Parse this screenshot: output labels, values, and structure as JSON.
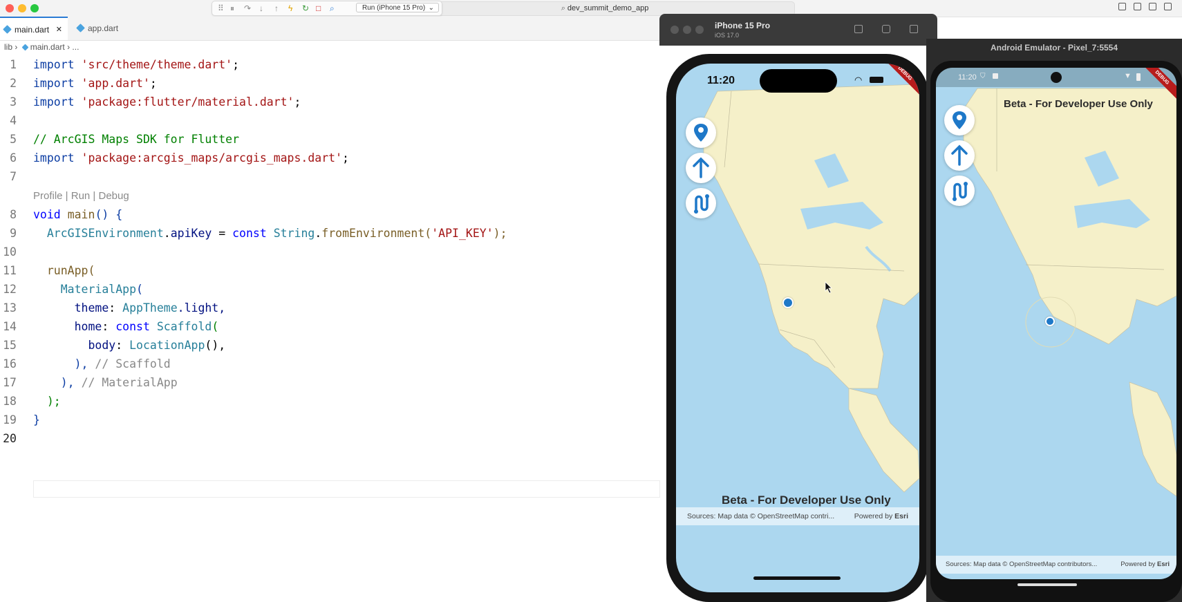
{
  "window": {
    "project_title": "dev_summit_demo_app"
  },
  "debug_toolbar": {
    "run_config": "Run (iPhone 15 Pro)"
  },
  "tabs": [
    {
      "label": "main.dart"
    },
    {
      "label": "app.dart"
    }
  ],
  "tab_close_glyph": "✕",
  "breadcrumb": {
    "folder": "lib",
    "file": "main.dart",
    "more": "..."
  },
  "code_lens": "Profile | Run | Debug",
  "code": {
    "line_numbers": [
      "1",
      "2",
      "3",
      "4",
      "5",
      "6",
      "7",
      "8",
      "9",
      "10",
      "11",
      "12",
      "13",
      "14",
      "15",
      "16",
      "17",
      "18",
      "19",
      "20"
    ],
    "l1": {
      "kw": "import",
      "str": "'src/theme/theme.dart'",
      "end": ";"
    },
    "l2": {
      "kw": "import",
      "str": "'app.dart'",
      "end": ";"
    },
    "l3": {
      "kw": "import",
      "str": "'package:flutter/material.dart'",
      "end": ";"
    },
    "l5": {
      "comment": "// ArcGIS Maps SDK for Flutter"
    },
    "l6": {
      "kw": "import",
      "str": "'package:arcgis_maps/arcgis_maps.dart'",
      "end": ";"
    },
    "l8": {
      "kw": "void",
      "fn": "main",
      "rest": "() {"
    },
    "l9": {
      "class": "ArcGISEnvironment",
      "dot": ".",
      "prop": "apiKey",
      "eq": " = ",
      "kw": "const",
      "type": "String",
      "dot2": ".",
      "fn": "fromEnvironment",
      "open": "(",
      "str": "'API_KEY'",
      "close": ");"
    },
    "l11": {
      "fn": "runApp",
      "open": "("
    },
    "l12": {
      "class": "MaterialApp",
      "open": "("
    },
    "l13": {
      "prop": "theme",
      "colon": ": ",
      "class": "AppTheme",
      "rest": ".light,"
    },
    "l14": {
      "prop": "home",
      "colon": ": ",
      "kw": "const",
      "class": "Scaffold",
      "open": "("
    },
    "l15": {
      "prop": "body",
      "colon": ": ",
      "class": "LocationApp",
      "rest": "(),"
    },
    "l16": {
      "rest": "), ",
      "comment": "// Scaffold"
    },
    "l17": {
      "rest": "), ",
      "comment": "// MaterialApp"
    },
    "l18": {
      "rest": ");"
    },
    "l19": {
      "rest": "}"
    }
  },
  "ios_sim": {
    "title": "iPhone 15 Pro",
    "subtitle": "iOS 17.0",
    "time": "11:20",
    "beta": "Beta - For Developer Use Only",
    "attribution": "Sources: Map data © OpenStreetMap contri...",
    "powered_by": "Powered by",
    "esri": "Esri",
    "debug_banner": "DEBUG"
  },
  "android_emu": {
    "title": "Android Emulator - Pixel_7:5554",
    "time": "11:20",
    "beta": "Beta - For Developer Use Only",
    "attribution": "Sources: Map data © OpenStreetMap contributors...",
    "powered_by": "Powered by",
    "esri": "Esri",
    "debug_banner": "DEBUG"
  },
  "icons": {
    "location_pin": "location-pin-icon",
    "navigate_up": "navigate-arrow-icon",
    "route": "route-icon"
  },
  "colors": {
    "accent": "#1e78c8",
    "water": "#acd7ef",
    "land": "#f5f0c9"
  }
}
